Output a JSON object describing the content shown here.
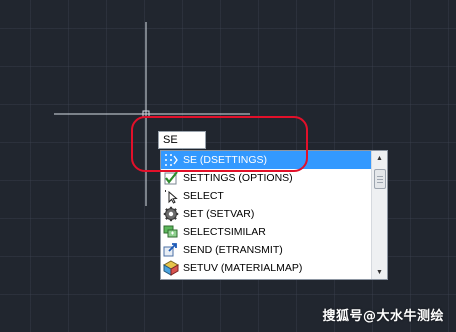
{
  "command_line": {
    "input_value": "SE"
  },
  "autocomplete": {
    "items": [
      {
        "label": "SE (DSETTINGS)",
        "icon": "settings-grid-icon",
        "selected": true
      },
      {
        "label": "SETTINGS (OPTIONS)",
        "icon": "checkmark-options-icon",
        "selected": false
      },
      {
        "label": "SELECT",
        "icon": "cursor-select-icon",
        "selected": false
      },
      {
        "label": "SET (SETVAR)",
        "icon": "gear-icon",
        "selected": false
      },
      {
        "label": "SELECTSIMILAR",
        "icon": "select-similar-icon",
        "selected": false
      },
      {
        "label": "SEND (ETRANSMIT)",
        "icon": "transmit-icon",
        "selected": false
      },
      {
        "label": "SETUV (MATERIALMAP)",
        "icon": "material-map-icon",
        "selected": false
      }
    ]
  },
  "scrollbar": {
    "up_glyph": "▲",
    "down_glyph": "▼"
  },
  "watermark": {
    "text": "搜狐号@大水牛测绘"
  },
  "colors": {
    "canvas_background": "#21262f",
    "selection": "#3399ff",
    "highlight_ring": "#e2102a"
  }
}
